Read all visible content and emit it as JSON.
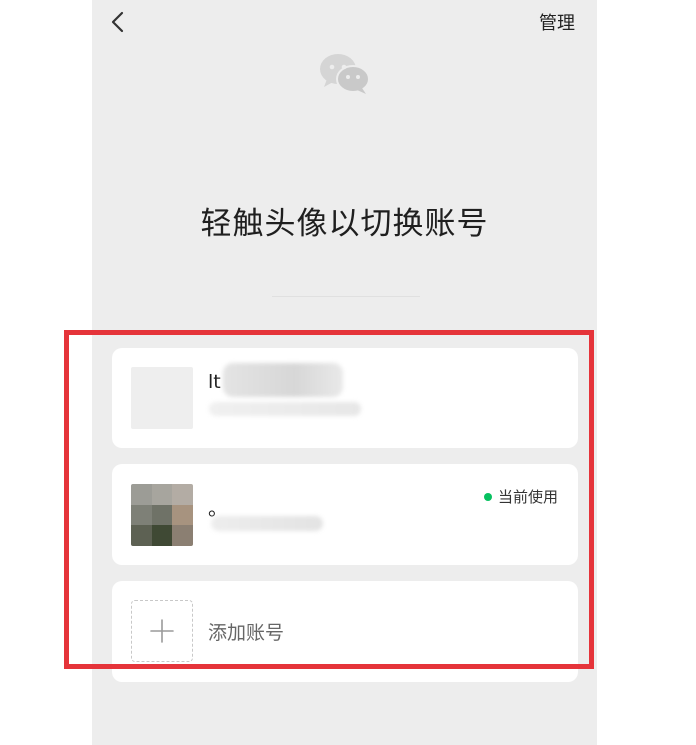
{
  "header": {
    "back_icon": "chevron-left-icon",
    "manage_label": "管理"
  },
  "logo": {
    "icon": "wechat-logo-icon"
  },
  "main": {
    "title": "轻触头像以切换账号"
  },
  "accounts": [
    {
      "name": "lt"
    },
    {
      "name": "。",
      "status_label": "当前使用",
      "status_color": "#07c160"
    }
  ],
  "add_account": {
    "icon": "plus-icon",
    "label": "添加账号"
  },
  "colors": {
    "background": "#ededed",
    "card": "#ffffff",
    "accent": "#07c160",
    "highlight": "#e5343a"
  }
}
